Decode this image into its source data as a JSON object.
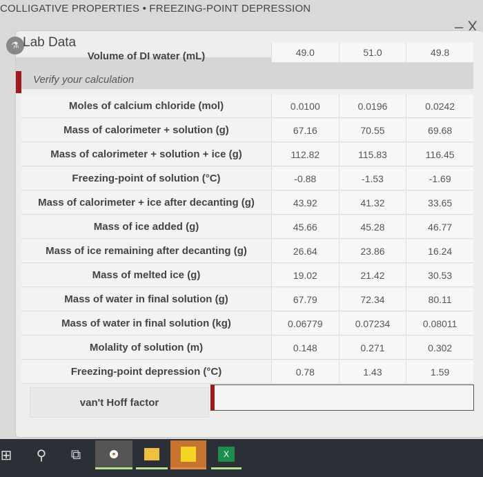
{
  "app_title": "COLLIGATIVE PROPERTIES • FREEZING-POINT DEPRESSION",
  "window_controls": {
    "minimize": "–",
    "close": "X"
  },
  "panel": {
    "title": "Lab Data",
    "verify_label": "Verify your calculation"
  },
  "top_row": {
    "label": "Volume of DI water (mL)",
    "values": [
      "49.0",
      "51.0",
      "49.8"
    ]
  },
  "rows": [
    {
      "label": "Moles of calcium chloride (mol)",
      "values": [
        "0.0100",
        "0.0196",
        "0.0242"
      ]
    },
    {
      "label": "Mass of calorimeter + solution (g)",
      "values": [
        "67.16",
        "70.55",
        "69.68"
      ]
    },
    {
      "label": "Mass of calorimeter + solution + ice (g)",
      "values": [
        "112.82",
        "115.83",
        "116.45"
      ]
    },
    {
      "label": "Freezing-point of solution (°C)",
      "values": [
        "-0.88",
        "-1.53",
        "-1.69"
      ]
    },
    {
      "label": "Mass of calorimeter + ice after decanting (g)",
      "values": [
        "43.92",
        "41.32",
        "33.65"
      ]
    },
    {
      "label": "Mass of ice added (g)",
      "values": [
        "45.66",
        "45.28",
        "46.77"
      ]
    },
    {
      "label": "Mass of ice remaining after decanting (g)",
      "values": [
        "26.64",
        "23.86",
        "16.24"
      ]
    },
    {
      "label": "Mass of melted ice (g)",
      "values": [
        "19.02",
        "21.42",
        "30.53"
      ]
    },
    {
      "label": "Mass of water in final solution (g)",
      "values": [
        "67.79",
        "72.34",
        "80.11"
      ]
    },
    {
      "label": "Mass of water in final solution (kg)",
      "values": [
        "0.06779",
        "0.07234",
        "0.08011"
      ]
    },
    {
      "label": "Molality of solution (m)",
      "values": [
        "0.148",
        "0.271",
        "0.302"
      ]
    },
    {
      "label": "Freezing-point depression (°C)",
      "values": [
        "0.78",
        "1.43",
        "1.59"
      ]
    }
  ],
  "vant_hoff": {
    "label": "van't Hoff factor",
    "value": ""
  },
  "taskbar": {
    "icons": [
      "windows-start-icon",
      "search-icon",
      "task-view-icon",
      "chrome-icon",
      "file-explorer-icon",
      "sticky-notes-icon",
      "excel-icon"
    ],
    "excel_letter": "X"
  },
  "colors": {
    "accent_red": "#9b1b1e",
    "taskbar": "#2b2f36"
  }
}
